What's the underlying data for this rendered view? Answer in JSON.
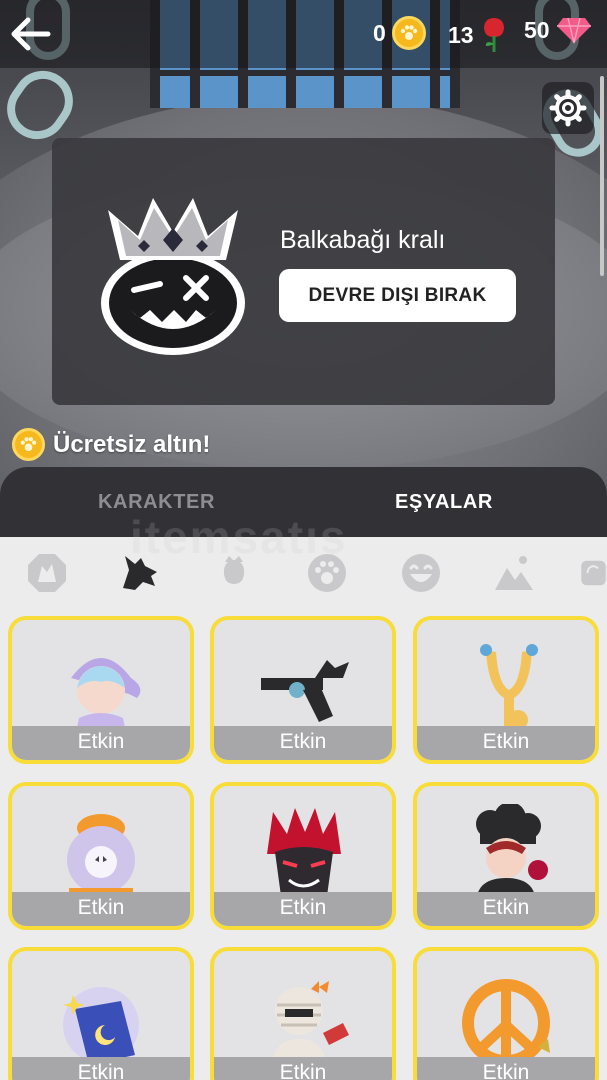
{
  "header": {
    "currencies": [
      {
        "name": "coin-balance",
        "icon": "paw-coin-icon",
        "value": "0"
      },
      {
        "name": "rose-balance",
        "icon": "rose-icon",
        "value": "13"
      },
      {
        "name": "gem-balance",
        "icon": "gem-icon",
        "value": "50"
      }
    ]
  },
  "equipped": {
    "item_name": "Balkabağı kralı",
    "deactivate_label": "DEVRE DIŞI BIRAK",
    "icon": "pumpkin-king-icon"
  },
  "free_gold": {
    "label": "Ücretsiz altın!"
  },
  "tabs": [
    {
      "label": "KARAKTER",
      "active": false
    },
    {
      "label": "EŞYALAR",
      "active": true
    }
  ],
  "watermark": "itemsatış",
  "categories": [
    {
      "icon": "werewolf-badge-icon",
      "selected": false
    },
    {
      "icon": "wolf-icon",
      "selected": true
    },
    {
      "icon": "rose-icon",
      "selected": false
    },
    {
      "icon": "paw-icon",
      "selected": false
    },
    {
      "icon": "smile-icon",
      "selected": false
    },
    {
      "icon": "landscape-icon",
      "selected": false
    },
    {
      "icon": "refresh-icon",
      "selected": false
    }
  ],
  "items": [
    {
      "icon": "sleepy-girl-icon",
      "status": "Etkin"
    },
    {
      "icon": "bat-revolver-icon",
      "status": "Etkin"
    },
    {
      "icon": "slingshot-icon",
      "status": "Etkin"
    },
    {
      "icon": "pumpkin-crystal-ball-icon",
      "status": "Etkin"
    },
    {
      "icon": "red-beast-icon",
      "status": "Etkin"
    },
    {
      "icon": "chef-icon",
      "status": "Etkin"
    },
    {
      "icon": "spell-book-icon",
      "status": "Etkin"
    },
    {
      "icon": "mummy-icon",
      "status": "Etkin"
    },
    {
      "icon": "peace-wreath-icon",
      "status": "Etkin"
    }
  ],
  "colors": {
    "item_border": "#f7dc3a",
    "coin": "#f6b81c",
    "rose": "#d8262e",
    "gem": "#f25b8a"
  }
}
